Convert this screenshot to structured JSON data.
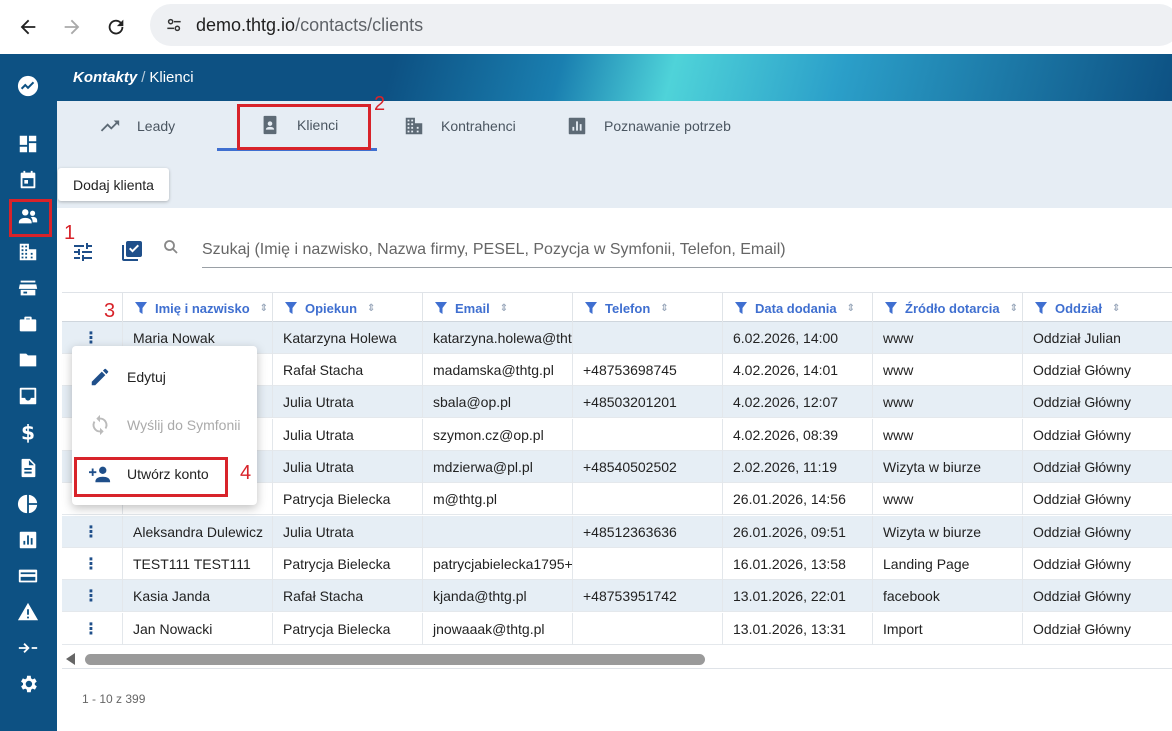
{
  "browser": {
    "url_host": "demo.thtg.io",
    "url_path": "/contacts/clients"
  },
  "header": {
    "section": "Kontakty",
    "page": "Klienci"
  },
  "tabs": [
    {
      "label": "Leady",
      "icon": "trending-up-icon"
    },
    {
      "label": "Klienci",
      "icon": "contact-card-icon"
    },
    {
      "label": "Kontrahenci",
      "icon": "building-icon"
    },
    {
      "label": "Poznawanie potrzeb",
      "icon": "bar-chart-icon"
    }
  ],
  "actions": {
    "add_client": "Dodaj klienta"
  },
  "search": {
    "placeholder": "Szukaj (Imię i nazwisko, Nazwa firmy, PESEL, Pozycja w Symfonii, Telefon, Email)"
  },
  "table": {
    "columns": [
      "Imię i nazwisko",
      "Opiekun",
      "Email",
      "Telefon",
      "Data dodania",
      "Źródło dotarcia",
      "Oddział"
    ],
    "rows": [
      [
        "Maria Nowak",
        "Katarzyna Holewa",
        "katarzyna.holewa@thtg",
        "",
        "6.02.2026, 14:00",
        "www",
        "Oddział Julian"
      ],
      [
        "",
        "Rafał Stacha",
        "madamska@thtg.pl",
        "+48753698745",
        "4.02.2026, 14:01",
        "www",
        "Oddział Główny"
      ],
      [
        "",
        "Julia Utrata",
        "sbala@op.pl",
        "+48503201201",
        "4.02.2026, 12:07",
        "www",
        "Oddział Główny"
      ],
      [
        "",
        "Julia Utrata",
        "szymon.cz@op.pl",
        "",
        "4.02.2026, 08:39",
        "www",
        "Oddział Główny"
      ],
      [
        "",
        "Julia Utrata",
        "mdzierwa@pl.pl",
        "+48540502502",
        "2.02.2026, 11:19",
        "Wizyta w biurze",
        "Oddział Główny"
      ],
      [
        "",
        "Patrycja Bielecka",
        "m@thtg.pl",
        "",
        "26.01.2026, 14:56",
        "www",
        "Oddział Główny"
      ],
      [
        "Aleksandra Dulewicz",
        "Julia Utrata",
        "",
        "+48512363636",
        "26.01.2026, 09:51",
        "Wizyta w biurze",
        "Oddział Główny"
      ],
      [
        "TEST111 TEST111",
        "Patrycja Bielecka",
        "patrycjabielecka1795+",
        "",
        "16.01.2026, 13:58",
        "Landing Page",
        "Oddział Główny"
      ],
      [
        "Kasia Janda",
        "Rafał Stacha",
        "kjanda@thtg.pl",
        "+48753951742",
        "13.01.2026, 22:01",
        "facebook",
        "Oddział Główny"
      ],
      [
        "Jan Nowacki",
        "Patrycja Bielecka",
        "jnowaaak@thtg.pl",
        "",
        "13.01.2026, 13:31",
        "Import",
        "Oddział Główny"
      ]
    ],
    "paginator": "1 - 10 z 399"
  },
  "context_menu": {
    "items": [
      {
        "label": "Edytuj",
        "icon": "pencil-icon",
        "disabled": false
      },
      {
        "label": "Wyślij do Symfonii",
        "icon": "sync-icon",
        "disabled": true
      },
      {
        "label": "Utwórz konto",
        "icon": "person-add-icon",
        "disabled": false
      }
    ]
  },
  "annotations": [
    "1",
    "2",
    "3",
    "4"
  ],
  "colors": {
    "rail": "#0d5183",
    "accent": "#3f6fd0",
    "highlight": "#d8232a"
  }
}
